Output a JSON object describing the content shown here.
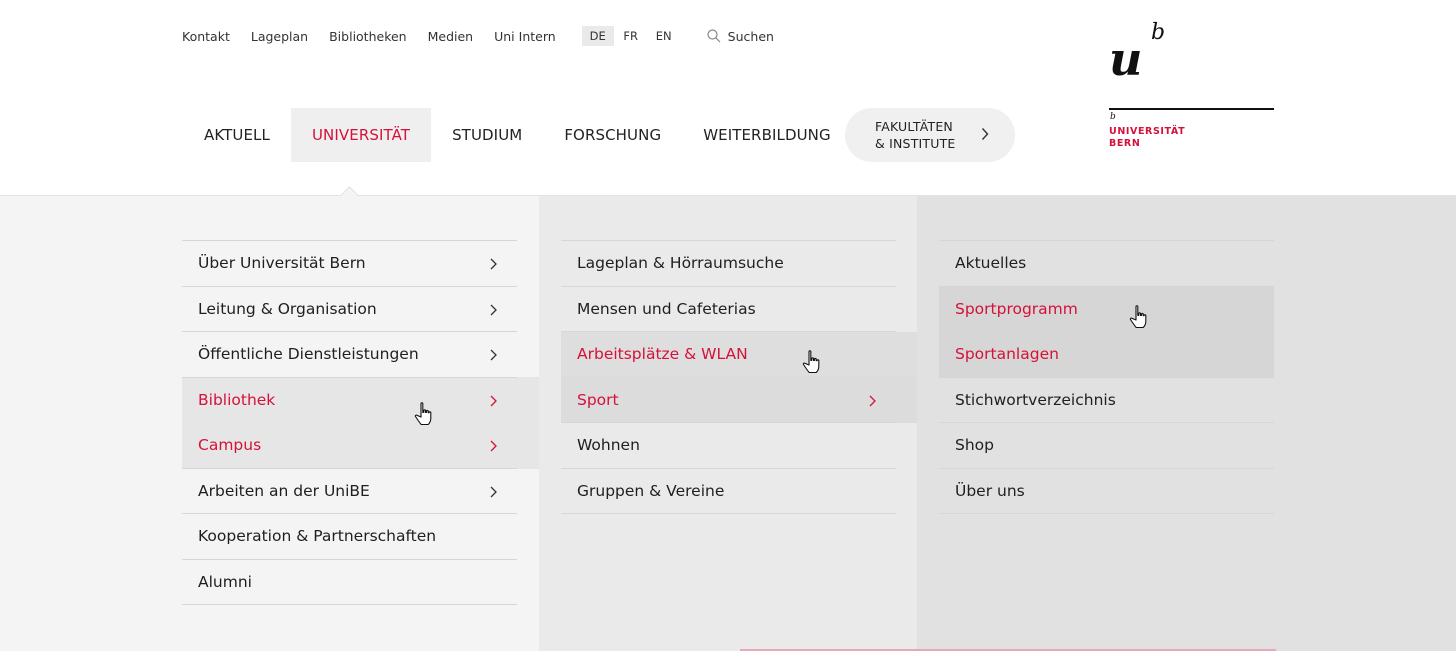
{
  "topbar": {
    "links": [
      "Kontakt",
      "Lageplan",
      "Bibliotheken",
      "Medien",
      "Uni Intern"
    ],
    "languages": [
      "DE",
      "FR",
      "EN"
    ],
    "active_language": "DE",
    "search_label": "Suchen"
  },
  "mainnav": {
    "items": [
      "AKTUELL",
      "UNIVERSITÄT",
      "STUDIUM",
      "FORSCHUNG",
      "WEITERBILDUNG"
    ],
    "active": "UNIVERSITÄT",
    "faculty_line1": "FAKULTÄTEN",
    "faculty_line2": "& INSTITUTE"
  },
  "logo": {
    "mark_u": "u",
    "mark_b": "b",
    "small_b": "b",
    "line1": "UNIVERSITÄT",
    "line2": "BERN"
  },
  "menu": {
    "col1": [
      {
        "label": "Über Universität Bern",
        "has_children": true
      },
      {
        "label": "Leitung & Organisation",
        "has_children": true
      },
      {
        "label": "Öffentliche Dienstleistungen",
        "has_children": true
      },
      {
        "label": "Bibliothek",
        "has_children": true
      },
      {
        "label": "Campus",
        "has_children": true
      },
      {
        "label": "Arbeiten an der UniBE",
        "has_children": true
      },
      {
        "label": "Kooperation & Partnerschaften",
        "has_children": false
      },
      {
        "label": "Alumni",
        "has_children": false
      }
    ],
    "col2": [
      {
        "label": "Lageplan & Hörraumsuche",
        "has_children": false
      },
      {
        "label": "Mensen und Cafeterias",
        "has_children": false
      },
      {
        "label": "Arbeitsplätze & WLAN",
        "has_children": false
      },
      {
        "label": "Sport",
        "has_children": true
      },
      {
        "label": "Wohnen",
        "has_children": false
      },
      {
        "label": "Gruppen & Vereine",
        "has_children": false
      }
    ],
    "col3": [
      {
        "label": "Aktuelles",
        "has_children": false
      },
      {
        "label": "Sportprogramm",
        "has_children": false
      },
      {
        "label": "Sportanlagen",
        "has_children": false
      },
      {
        "label": "Stichwortverzeichnis",
        "has_children": false
      },
      {
        "label": "Shop",
        "has_children": false
      },
      {
        "label": "Über uns",
        "has_children": false
      }
    ]
  },
  "colors": {
    "accent": "#d5113a",
    "text": "#1f1f1f",
    "panel": "#f4f4f4"
  }
}
